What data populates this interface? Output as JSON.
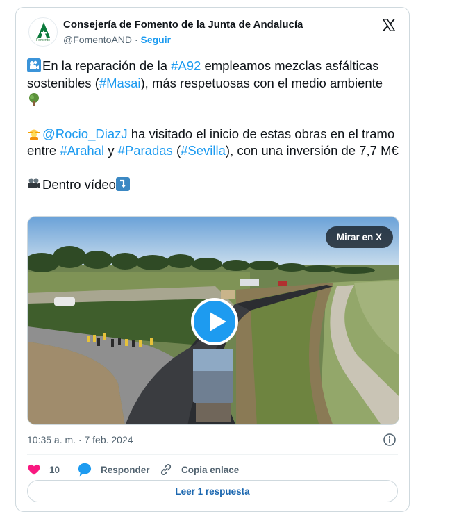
{
  "account": {
    "name": "Consejería de Fomento de la Junta de Andalucía",
    "handle": "@FomentoAND",
    "separator": "·",
    "follow_label": "Seguir",
    "avatar_caption": "Fomento"
  },
  "tweet": {
    "p1_pre": "En la reparación de la ",
    "p1_tag1": "#A92",
    "p1_mid": " empleamos mezclas asfálticas sostenibles (",
    "p1_tag2": "#Masai",
    "p1_post": "), más respetuosas con el medio ambiente",
    "p2_mention": "@Rocio_DiazJ",
    "p2_mid1": " ha visitado el inicio de estas obras en el tramo entre ",
    "p2_tag1": "#Arahal",
    "p2_mid2": " y ",
    "p2_tag2": "#Paradas",
    "p2_mid3": " (",
    "p2_tag3": "#Sevilla",
    "p2_post": "), con una inversión de 7,7 M€",
    "p3_text": "Dentro vídeo"
  },
  "media": {
    "watch_label": "Mirar en X"
  },
  "timestamp": "10:35 a. m. · 7 feb. 2024",
  "actions": {
    "like_count": "10",
    "reply_label": "Responder",
    "copy_label": "Copia enlace"
  },
  "read_replies_label": "Leer 1 respuesta",
  "colors": {
    "link": "#1d9bf0",
    "like": "#f91880",
    "secondary_text": "#536471"
  }
}
